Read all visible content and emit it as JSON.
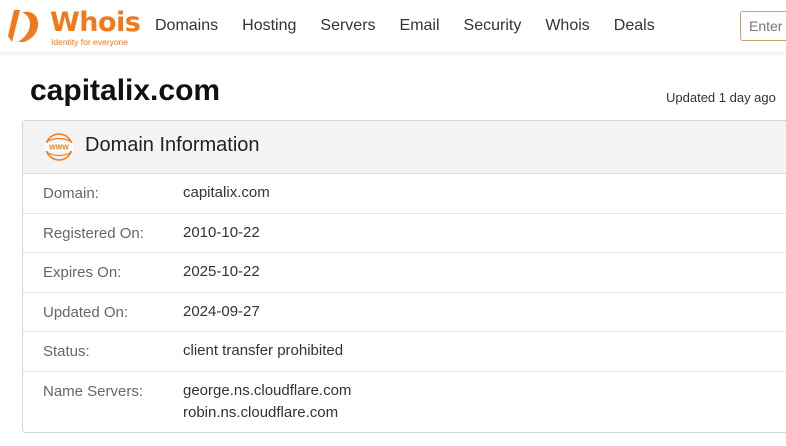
{
  "brand": {
    "name": "Whois",
    "tagline": "Identity for everyone",
    "accent": "#f07a1a"
  },
  "nav": {
    "items": [
      {
        "label": "Domains"
      },
      {
        "label": "Hosting"
      },
      {
        "label": "Servers"
      },
      {
        "label": "Email"
      },
      {
        "label": "Security"
      },
      {
        "label": "Whois"
      },
      {
        "label": "Deals"
      }
    ]
  },
  "search": {
    "placeholder": "Enter"
  },
  "page": {
    "domain": "capitalix.com",
    "updated": "Updated 1 day ago"
  },
  "card": {
    "title": "Domain Information",
    "icon": "www-icon",
    "rows": [
      {
        "label": "Domain:",
        "value": "capitalix.com"
      },
      {
        "label": "Registered On:",
        "value": "2010-10-22"
      },
      {
        "label": "Expires On:",
        "value": "2025-10-22"
      },
      {
        "label": "Updated On:",
        "value": "2024-09-27"
      },
      {
        "label": "Status:",
        "value": "client transfer prohibited"
      },
      {
        "label": "Name Servers:",
        "values": [
          "george.ns.cloudflare.com",
          "robin.ns.cloudflare.com"
        ]
      }
    ]
  }
}
